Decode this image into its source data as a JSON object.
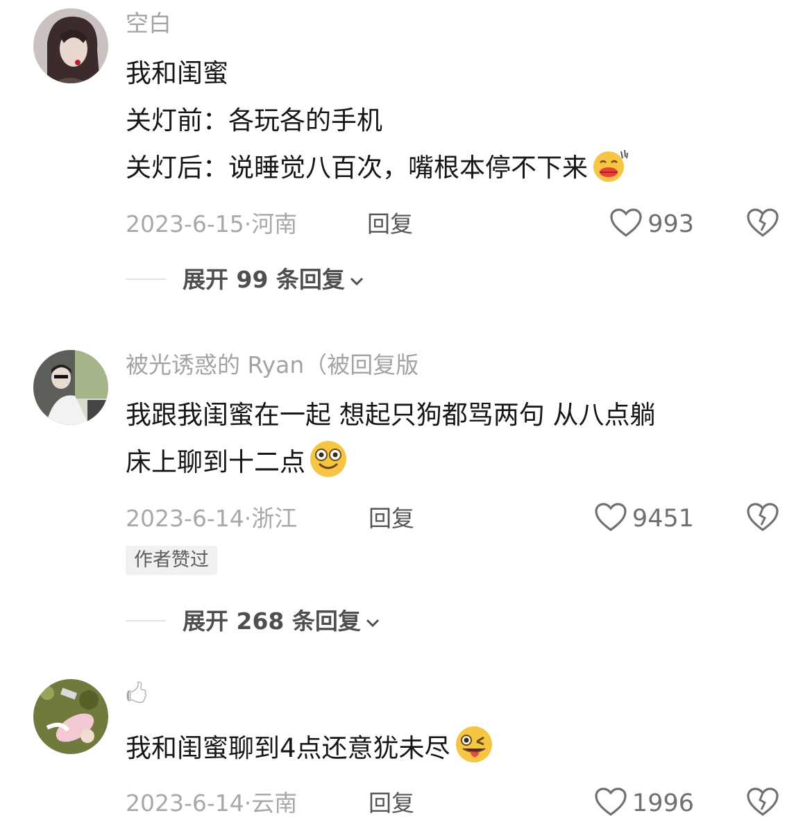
{
  "comments": [
    {
      "username": "空白",
      "lines": [
        "我和闺蜜",
        "关灯前：各玩各的手机",
        "关灯后：说睡觉八百次，嘴根本停不下来"
      ],
      "emoji": "kiss-emoji",
      "date": "2023-6-15·",
      "region": "河南",
      "reply_label": "回复",
      "likes": "993",
      "expand_label": "展开 99 条回复"
    },
    {
      "username": "被光诱惑的 Ryan（被回复版",
      "lines": [
        "我跟我闺蜜在一起 想起只狗都骂两句 从八点躺",
        "床上聊到十二点"
      ],
      "emoji": "dizzy-smile-emoji",
      "date": "2023-6-14·",
      "region": "浙江",
      "reply_label": "回复",
      "likes": "9451",
      "badge": "作者赞过",
      "expand_label": "展开 268 条回复"
    },
    {
      "username": "🖒",
      "lines": [
        "我和闺蜜聊到4点还意犹未尽"
      ],
      "emoji": "wink-tongue-emoji",
      "date": "2023-6-14·",
      "region": "云南",
      "reply_label": "回复",
      "likes": "1996"
    }
  ],
  "colors": {
    "text": "#161616",
    "meta": "#a8a8a8",
    "username": "#a3a3a3",
    "icon": "#6f6f6f",
    "badge_bg": "#f1f1f1"
  }
}
